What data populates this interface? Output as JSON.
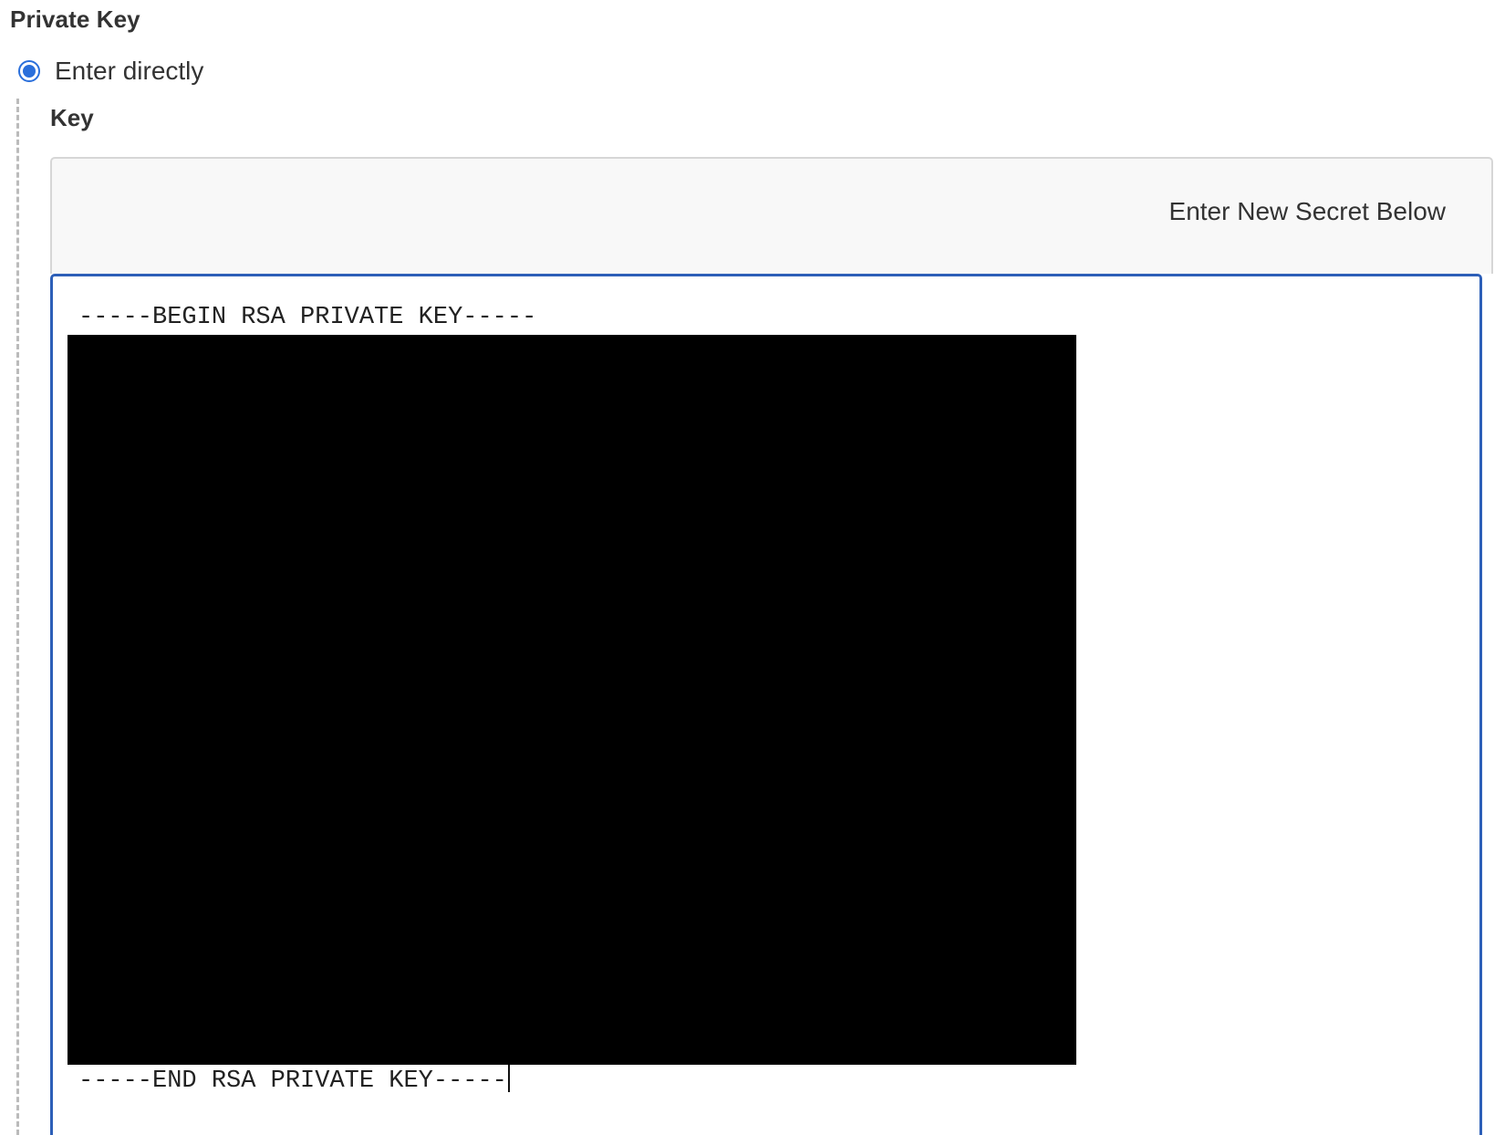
{
  "section": {
    "title": "Private Key"
  },
  "source_option": {
    "label": "Enter directly",
    "selected": true
  },
  "key_field": {
    "label": "Key",
    "header_hint": "Enter New Secret Below",
    "begin_line": "-----BEGIN RSA PRIVATE KEY-----",
    "end_line": "-----END RSA PRIVATE KEY-----"
  },
  "colors": {
    "accent": "#2a6fdb",
    "focus_border": "#2d5fb8",
    "redaction": "#000000"
  }
}
